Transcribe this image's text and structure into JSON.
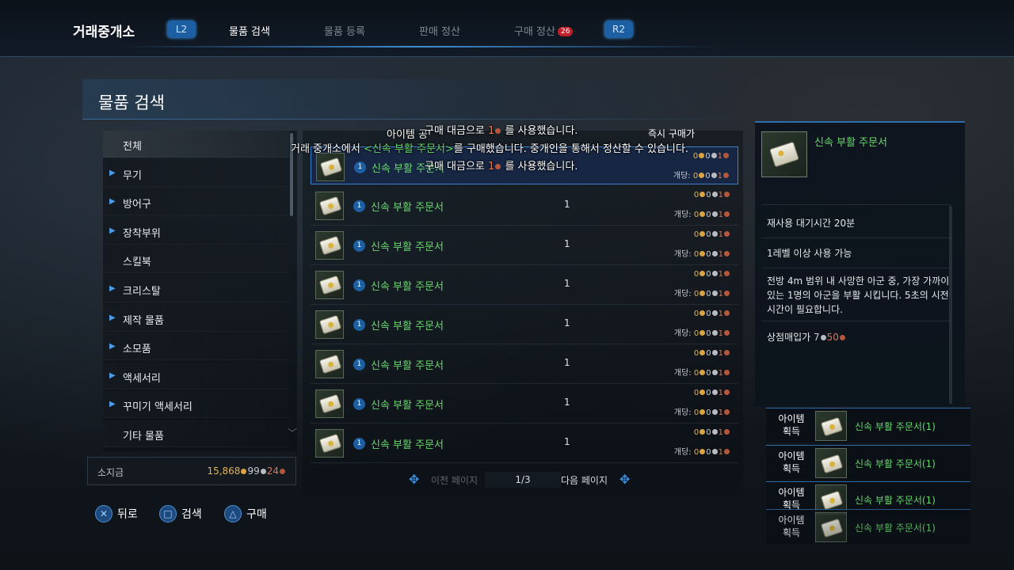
{
  "header": {
    "brand": "거래중개소",
    "left_shoulder": "L2",
    "right_shoulder": "R2",
    "tabs": [
      {
        "label": "물품 검색",
        "active": true
      },
      {
        "label": "물품 등록",
        "active": false
      },
      {
        "label": "판매 정산",
        "active": false
      },
      {
        "label": "구매 정산",
        "active": false,
        "badge": "26"
      }
    ]
  },
  "panel": {
    "title": "물품 검색"
  },
  "categories": [
    {
      "label": "전체",
      "expandable": false,
      "selected": true
    },
    {
      "label": "무기",
      "expandable": true
    },
    {
      "label": "방어구",
      "expandable": true
    },
    {
      "label": "장착부위",
      "expandable": true
    },
    {
      "label": "스킬북",
      "expandable": false
    },
    {
      "label": "크리스탈",
      "expandable": true
    },
    {
      "label": "제작 물품",
      "expandable": true
    },
    {
      "label": "소모품",
      "expandable": true
    },
    {
      "label": "액세서리",
      "expandable": true
    },
    {
      "label": "꾸미기 액세서리",
      "expandable": true
    },
    {
      "label": "기타 물품",
      "expandable": false
    }
  ],
  "money": {
    "label": "소지금",
    "gold": "15,868",
    "silver": "99",
    "copper": "24"
  },
  "list": {
    "instant_buy_header": "즉시 구매가",
    "unit_price_label": "개당:",
    "rows": [
      {
        "level": "1",
        "name": "신속 부활 주문서",
        "qty": "1",
        "price": [
          "0",
          "0",
          "1"
        ],
        "unit": [
          "0",
          "0",
          "1"
        ]
      },
      {
        "level": "1",
        "name": "신속 부활 주문서",
        "qty": "1",
        "price": [
          "0",
          "0",
          "1"
        ],
        "unit": [
          "0",
          "0",
          "1"
        ]
      },
      {
        "level": "1",
        "name": "신속 부활 주문서",
        "qty": "1",
        "price": [
          "0",
          "0",
          "1"
        ],
        "unit": [
          "0",
          "0",
          "1"
        ]
      },
      {
        "level": "1",
        "name": "신속 부활 주문서",
        "qty": "1",
        "price": [
          "0",
          "0",
          "1"
        ],
        "unit": [
          "0",
          "0",
          "1"
        ]
      },
      {
        "level": "1",
        "name": "신속 부활 주문서",
        "qty": "1",
        "price": [
          "0",
          "0",
          "1"
        ],
        "unit": [
          "0",
          "0",
          "1"
        ]
      },
      {
        "level": "1",
        "name": "신속 부활 주문서",
        "qty": "1",
        "price": [
          "0",
          "0",
          "1"
        ],
        "unit": [
          "0",
          "0",
          "1"
        ]
      },
      {
        "level": "1",
        "name": "신속 부활 주문서",
        "qty": "1",
        "price": [
          "0",
          "0",
          "1"
        ],
        "unit": [
          "0",
          "0",
          "1"
        ]
      },
      {
        "level": "1",
        "name": "신속 부활 주문서",
        "qty": "1",
        "price": [
          "0",
          "0",
          "1"
        ],
        "unit": [
          "0",
          "0",
          "1"
        ]
      }
    ]
  },
  "pager": {
    "prev": "이전 페이지",
    "page": "1/3",
    "next": "다음 페이지"
  },
  "buttons": {
    "back": "뒤로",
    "search": "검색",
    "buy": "구매"
  },
  "detail": {
    "name": "신속 부활 주문서",
    "cooldown": "재사용 대기시간  20분",
    "level_req": "1레벨 이상 사용 가능",
    "description": "전방 4m 범위 내 사망한 아군 중, 가장 가까이 있는 1명의 아군을 부활 시킵니다. 5초의 시전 시간이 필요합니다.",
    "shop_label": "상점매입가",
    "shop_silver": "7",
    "shop_copper": "50"
  },
  "toasts": [
    {
      "label": "아이템 획득",
      "item": "신속 부활 주문서(1)"
    },
    {
      "label": "아이템 획득",
      "item": "신속 부활 주문서(1)"
    },
    {
      "label": "아이템 획득",
      "item": "신속 부활 주문서(1)"
    },
    {
      "label": "아이템 획득",
      "item": "신속 부활 주문서(1)"
    }
  ],
  "system_messages": {
    "line1_prefix": "아이템 공",
    "line1": "구매 대금으로 ",
    "line1_num": "1",
    "line1_suffix": " 를 사용했습니다.",
    "line2_prefix": "거래 중개소에서 ",
    "line2_item": "<신속 부활 주문서>",
    "line2_suffix": "를 구매했습니다. 중개인을 통해서 정산할 수 있습니다.",
    "line3": "구매 대금으로 ",
    "line3_num": "1",
    "line3_suffix": " 를 사용했습니다."
  },
  "colors": {
    "item_green": "#69d86e",
    "accent_blue": "#3d7fcf",
    "gold": "#e0b458",
    "copper": "#d0785a",
    "badge_red": "#c0202a"
  }
}
